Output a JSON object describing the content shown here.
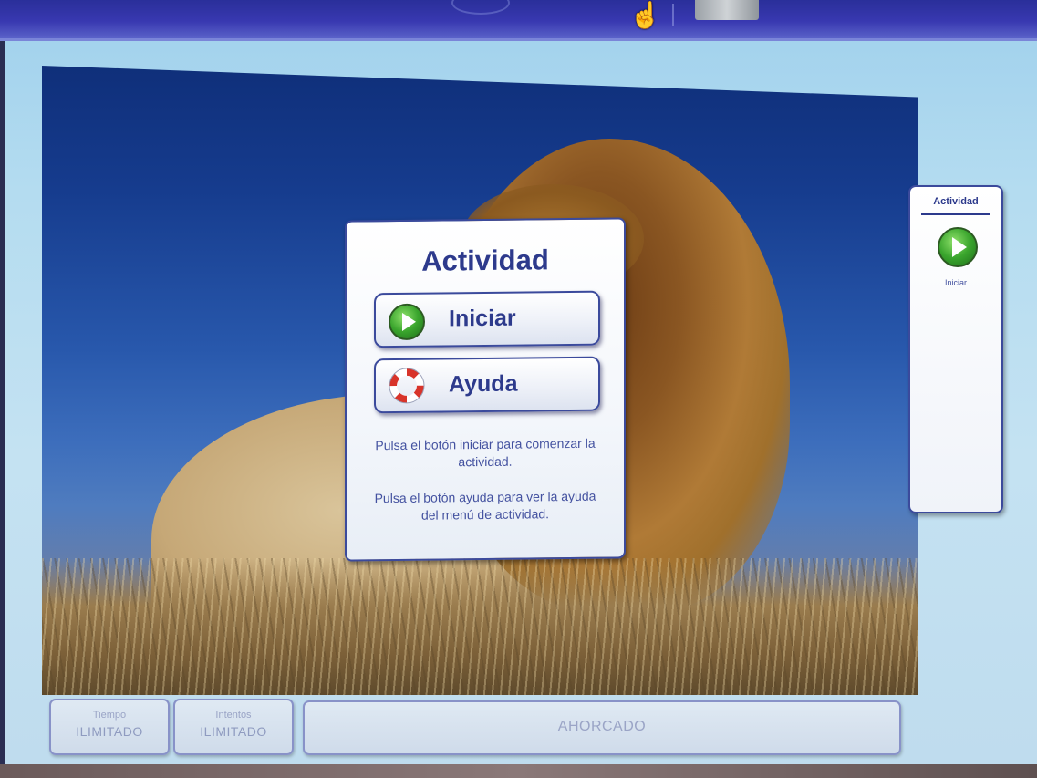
{
  "dialog": {
    "title": "Actividad",
    "start_label": "Iniciar",
    "help_label": "Ayuda",
    "start_hint": "Pulsa el botón iniciar para comenzar la actividad.",
    "help_hint": "Pulsa el botón ayuda para ver la ayuda del menú de actividad."
  },
  "side_panel": {
    "title": "Actividad",
    "start_label": "Iniciar"
  },
  "status": {
    "time_label": "Tiempo",
    "time_value": "ILIMITADO",
    "attempts_label": "Intentos",
    "attempts_value": "ILIMITADO",
    "activity_name": "AHORCADO"
  },
  "icons": {
    "start": "play-icon",
    "help": "lifebuoy-icon",
    "cursor": "hand-pointer-icon"
  },
  "colors": {
    "accent": "#2d3a8c",
    "play_green": "#3aa52d",
    "topbar": "#3838b0"
  }
}
